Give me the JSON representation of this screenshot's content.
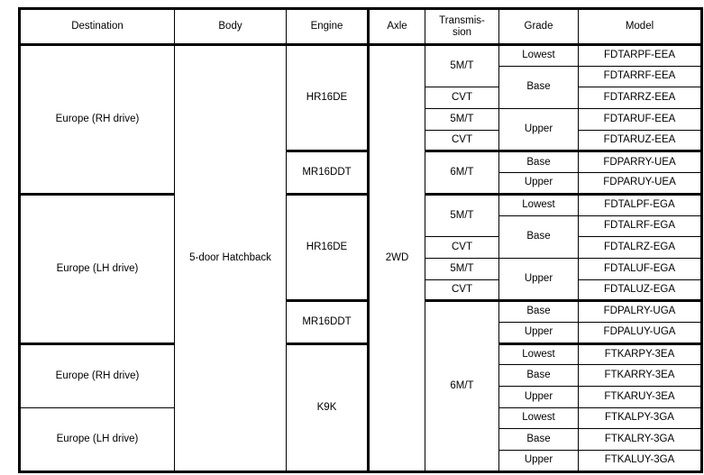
{
  "table": {
    "headers": [
      {
        "key": "destination",
        "label": "Destination"
      },
      {
        "key": "body",
        "label": "Body"
      },
      {
        "key": "engine",
        "label": "Engine"
      },
      {
        "key": "axle",
        "label": "Axle"
      },
      {
        "key": "transmission",
        "label": "Transmis-\nsion",
        "line1": "Transmis-",
        "line2": "sion"
      },
      {
        "key": "grade",
        "label": "Grade"
      },
      {
        "key": "model",
        "label": "Model"
      }
    ],
    "shared": {
      "body": "5-door Hatchback",
      "axle": "2WD"
    },
    "destinations": [
      {
        "label": "Europe (RH drive)"
      },
      {
        "label": "Europe (LH drive)"
      },
      {
        "label": "Europe (RH drive)"
      },
      {
        "label": "Europe (LH drive)"
      }
    ],
    "engines": [
      {
        "label": "HR16DE"
      },
      {
        "label": "MR16DDT"
      },
      {
        "label": "HR16DE"
      },
      {
        "label": "MR16DDT"
      },
      {
        "label": "K9K"
      }
    ],
    "transmissions": [
      {
        "label": "5M/T"
      },
      {
        "label": "CVT"
      },
      {
        "label": "5M/T"
      },
      {
        "label": "CVT"
      },
      {
        "label": "6M/T"
      },
      {
        "label": "5M/T"
      },
      {
        "label": "CVT"
      },
      {
        "label": "5M/T"
      },
      {
        "label": "CVT"
      },
      {
        "label": "6M/T"
      }
    ],
    "grades": [
      {
        "label": "Lowest"
      },
      {
        "label": "Base"
      },
      {
        "label": "Upper"
      },
      {
        "label": "Base"
      },
      {
        "label": "Upper"
      },
      {
        "label": "Lowest"
      },
      {
        "label": "Base"
      },
      {
        "label": "Upper"
      },
      {
        "label": "Base"
      },
      {
        "label": "Upper"
      },
      {
        "label": "Lowest"
      },
      {
        "label": "Base"
      },
      {
        "label": "Upper"
      },
      {
        "label": "Lowest"
      },
      {
        "label": "Base"
      },
      {
        "label": "Upper"
      }
    ],
    "models": [
      {
        "code": "FDTARPF-EEA"
      },
      {
        "code": "FDTARRF-EEA"
      },
      {
        "code": "FDTARRZ-EEA"
      },
      {
        "code": "FDTARUF-EEA"
      },
      {
        "code": "FDTARUZ-EEA"
      },
      {
        "code": "FDPARRY-UEA"
      },
      {
        "code": "FDPARUY-UEA"
      },
      {
        "code": "FDTALPF-EGA"
      },
      {
        "code": "FDTALRF-EGA"
      },
      {
        "code": "FDTALRZ-EGA"
      },
      {
        "code": "FDTALUF-EGA"
      },
      {
        "code": "FDTALUZ-EGA"
      },
      {
        "code": "FDPALRY-UGA"
      },
      {
        "code": "FDPALUY-UGA"
      },
      {
        "code": "FTKARPY-3EA"
      },
      {
        "code": "FTKARRY-3EA"
      },
      {
        "code": "FTKARUY-3EA"
      },
      {
        "code": "FTKALPY-3GA"
      },
      {
        "code": "FTKALRY-3GA"
      },
      {
        "code": "FTKALUY-3GA"
      }
    ]
  },
  "colors": {
    "border": "#000000",
    "text": "#000000",
    "background": "#ffffff"
  }
}
